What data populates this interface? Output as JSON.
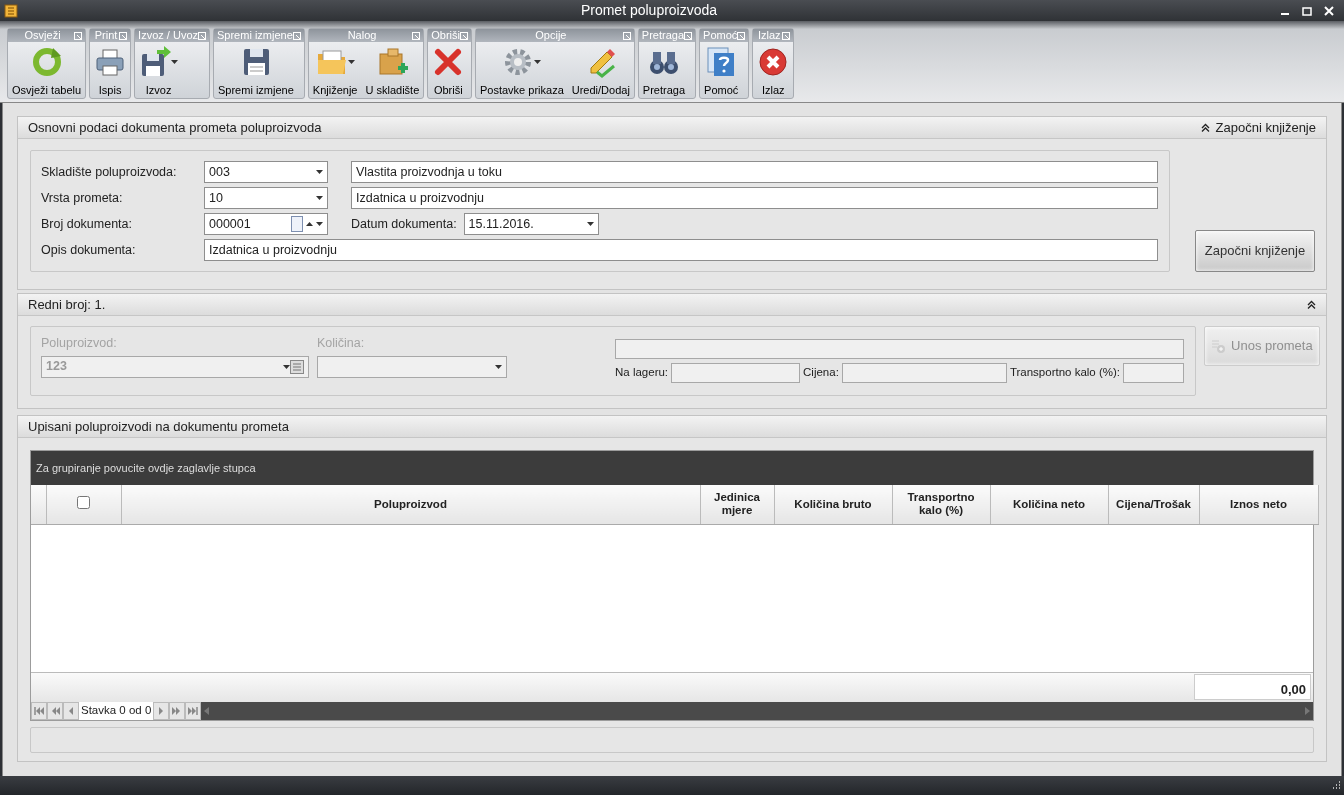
{
  "window": {
    "title": "Promet poluproizvoda"
  },
  "ribbon": {
    "groups": [
      {
        "caption": "Osvježi",
        "buttons": [
          {
            "label": "Osvježi tabelu",
            "kind": "refresh",
            "dropdown": false
          }
        ]
      },
      {
        "caption": "Print",
        "buttons": [
          {
            "label": "Ispis",
            "kind": "print",
            "dropdown": false
          }
        ]
      },
      {
        "caption": "Izvoz / Uvoz",
        "buttons": [
          {
            "label": "Izvoz",
            "kind": "export",
            "dropdown": true
          }
        ]
      },
      {
        "caption": "Spremi izmjene",
        "buttons": [
          {
            "label": "Spremi izmjene",
            "kind": "save",
            "dropdown": false
          }
        ]
      },
      {
        "caption": "Nalog",
        "buttons": [
          {
            "label": "Knjiženje",
            "kind": "folder",
            "dropdown": true
          },
          {
            "label": "U skladište",
            "kind": "boxes",
            "dropdown": false
          }
        ]
      },
      {
        "caption": "Obriši",
        "buttons": [
          {
            "label": "Obriši",
            "kind": "delete",
            "dropdown": false
          }
        ]
      },
      {
        "caption": "Opcije",
        "buttons": [
          {
            "label": "Postavke prikaza",
            "kind": "gear",
            "dropdown": true
          },
          {
            "label": "Uredi/Dodaj",
            "kind": "edit",
            "dropdown": false
          }
        ]
      },
      {
        "caption": "Pretraga",
        "buttons": [
          {
            "label": "Pretraga",
            "kind": "search",
            "dropdown": false
          }
        ]
      },
      {
        "caption": "Pomoć",
        "buttons": [
          {
            "label": "Pomoć",
            "kind": "help",
            "dropdown": false
          }
        ]
      },
      {
        "caption": "Izlaz",
        "buttons": [
          {
            "label": "Izlaz",
            "kind": "exit",
            "dropdown": false
          }
        ]
      }
    ]
  },
  "document_panel": {
    "title": "Osnovni podaci dokumenta prometa poluproizvoda",
    "collapse_label": "Započni knjiženje",
    "warehouse": {
      "label": "Skladište poluproizvoda:",
      "code": "003",
      "name": "Vlastita proizvodnja u toku"
    },
    "movement_type": {
      "label": "Vrsta prometa:",
      "code": "10",
      "name": "Izdatnica u proizvodnju"
    },
    "document_number": {
      "label": "Broj dokumenta:",
      "value": "000001"
    },
    "document_date": {
      "label": "Datum dokumenta:",
      "value": "15.11.2016."
    },
    "description": {
      "label": "Opis dokumenta:",
      "value": "Izdatnica u proizvodnju"
    },
    "start_button": {
      "label": "Započni knjiženje",
      "disabled": false
    }
  },
  "item_panel": {
    "title": "Redni broj: 1.",
    "disabled": true,
    "product_label": "Poluproizvod:",
    "product_glyph": "123",
    "quantity_label": "Količina:",
    "stock_label": "Na lageru:",
    "price_label": "Cijena:",
    "transport_label": "Transportno kalo (%):",
    "add_button": {
      "label": "Unos prometa",
      "disabled": true
    }
  },
  "grid_panel": {
    "title": "Upisani poluproizvodi na dokumentu prometa",
    "group_hint": "Za grupiranje povucite ovdje zaglavlje stupca",
    "select_all": {
      "checked": false
    },
    "columns": [
      "Poluproizvod",
      "Jedinica mjere",
      "Količina bruto",
      "Transportno kalo (%)",
      "Količina neto",
      "Cijena/Trošak",
      "Iznos neto"
    ],
    "total": "0,00",
    "navigator": "Stavka 0 od 0"
  }
}
